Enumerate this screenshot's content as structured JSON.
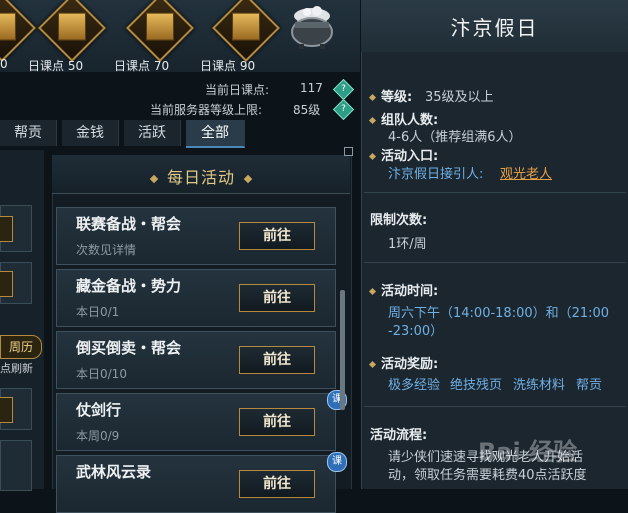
{
  "rewards": {
    "tiers": [
      {
        "label": "0"
      },
      {
        "label": "日课点 50"
      },
      {
        "label": "日课点 70"
      },
      {
        "label": "日课点 90"
      }
    ]
  },
  "stats": {
    "current_points_label": "当前日课点:",
    "current_points_value": "117",
    "server_level_label": "当前服务器等级上限:",
    "server_level_value": "85级",
    "help_icon": "?"
  },
  "tabs": [
    "帮贡",
    "金钱",
    "活跃",
    "全部"
  ],
  "left": {
    "weekly_tag": "周历",
    "refresh_note": "点刷新"
  },
  "panel": {
    "title": "每日活动",
    "activities": [
      {
        "name": "联赛备战・帮会",
        "sub": "次数见详情",
        "button": "前往"
      },
      {
        "name": "藏金备战・势力",
        "sub": "本日0/1",
        "button": "前往"
      },
      {
        "name": "倒买倒卖・帮会",
        "sub": "本日0/10",
        "button": "前往"
      },
      {
        "name": "仗剑行",
        "sub": "本周0/9",
        "button": "前往",
        "badge": "课"
      },
      {
        "name": "武林风云录",
        "sub": "",
        "button": "前往",
        "badge": "课"
      }
    ]
  },
  "detail": {
    "title": "汴京假日",
    "level_label": "等级:",
    "level_value": "35级及以上",
    "team_label": "组队人数:",
    "team_value": "4-6人（推荐组满6人）",
    "entry_label": "活动入口:",
    "entry_prefix": "汴京假日接引人:",
    "entry_link": "观光老人",
    "limit_label": "限制次数:",
    "limit_value": "1环/周",
    "time_label": "活动时间:",
    "time_line1": "周六下午（14:00-18:00）和（21:00",
    "time_line2": "-23:00）",
    "reward_label": "活动奖励:",
    "rewards": [
      "极多经验",
      "绝技残页",
      "洗练材料",
      "帮贡"
    ],
    "flow_label": "活动流程:",
    "flow_line1": "请少侠们速速寻找观光老人开始活",
    "flow_line2": "动，领取任务需要耗费40点活跃度"
  },
  "watermark": "Bai 经验"
}
